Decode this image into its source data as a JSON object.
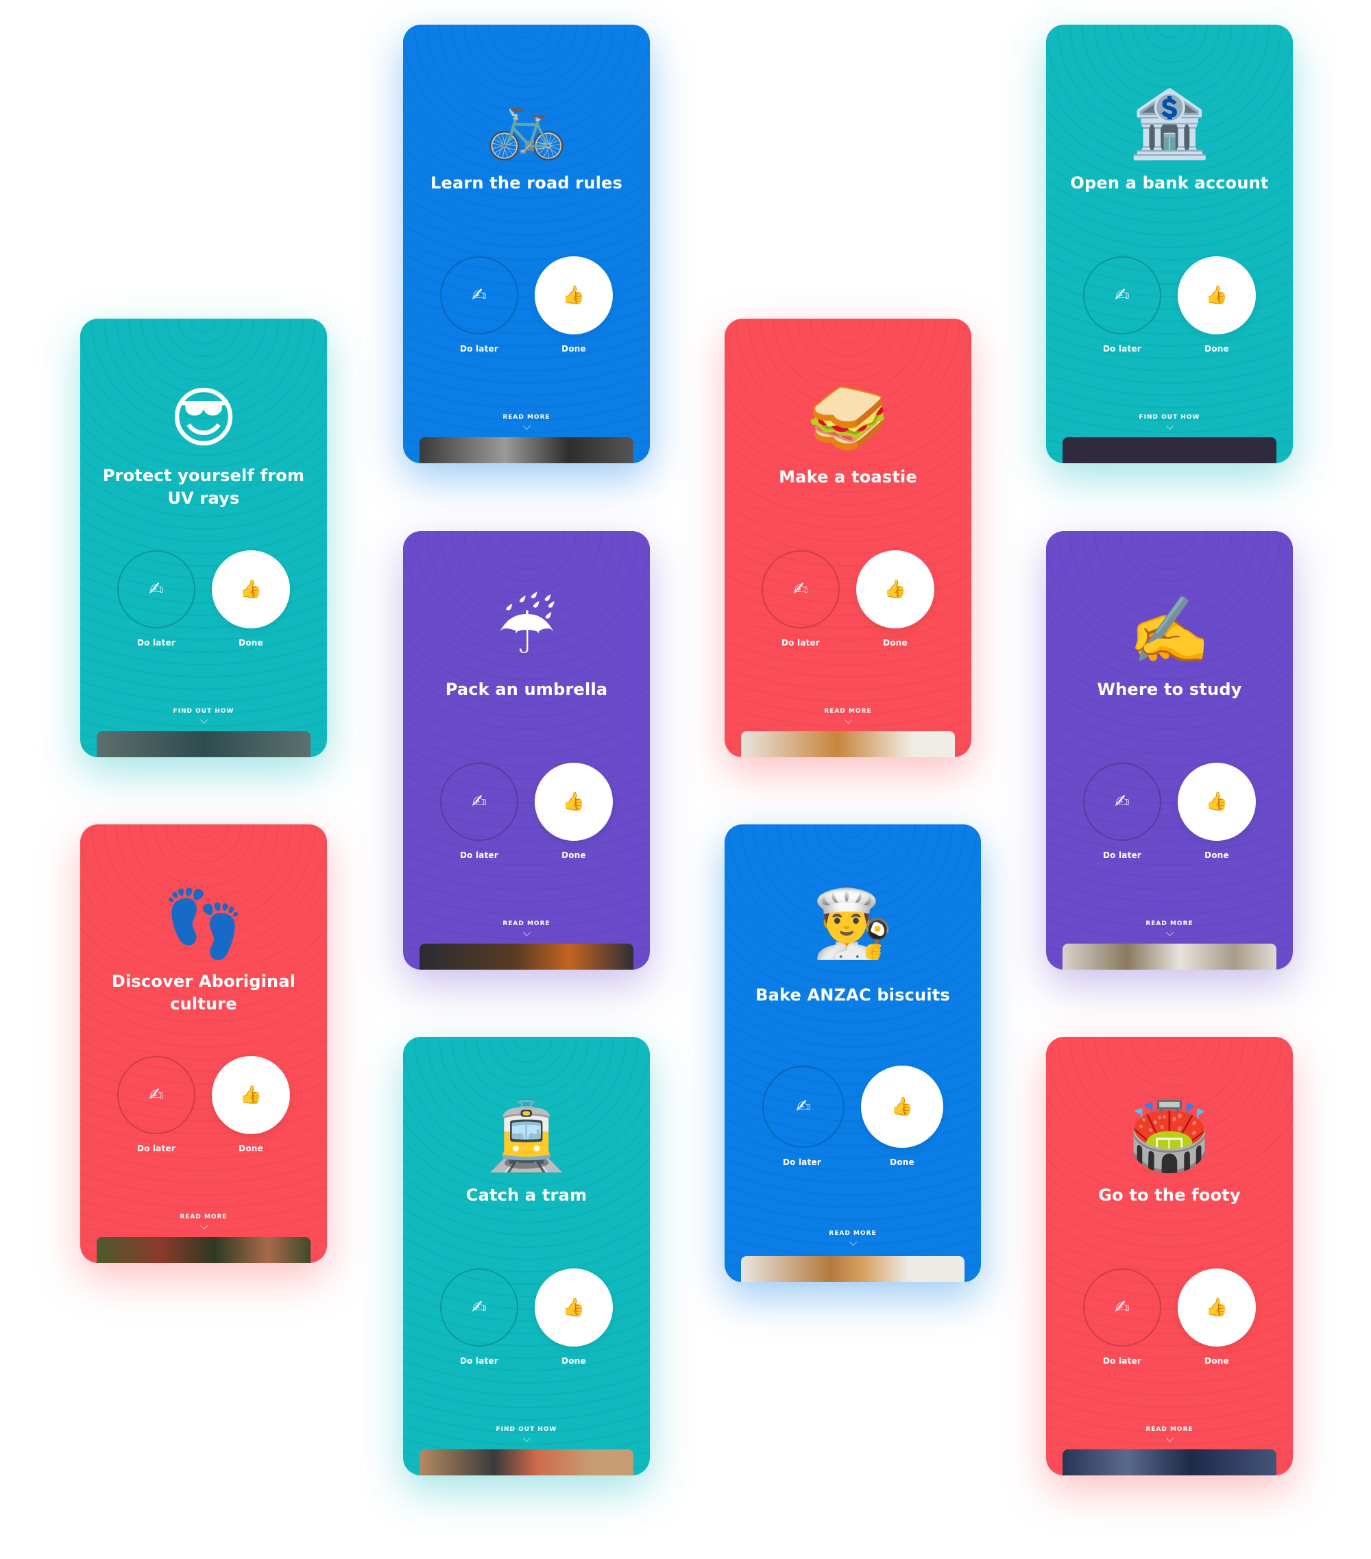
{
  "labels": {
    "do_later": "Do later",
    "done": "Done",
    "do_later_icon": "✍",
    "done_icon": "👍"
  },
  "cards": [
    {
      "title": "Learn the road rules",
      "emoji": "🚲",
      "link": "READ MORE",
      "color": "#0a7de6"
    },
    {
      "title": "Open a bank account",
      "emoji": "🏦",
      "link": "FIND OUT HOW",
      "color": "#0fb9be"
    },
    {
      "title": "Protect yourself from UV rays",
      "emoji": "😎",
      "link": "FIND OUT HOW",
      "color": "#0fb9be"
    },
    {
      "title": "Make a toastie",
      "emoji": "🥪",
      "link": "READ MORE",
      "color": "#fb4d57"
    },
    {
      "title": "Pack an umbrella",
      "emoji": "☔",
      "link": "READ MORE",
      "color": "#6a4bc9"
    },
    {
      "title": "Where to study",
      "emoji": "✍️",
      "link": "READ MORE",
      "color": "#6a4bc9"
    },
    {
      "title": "Discover Aboriginal culture",
      "emoji": "👣",
      "link": "READ MORE",
      "color": "#fb4d57"
    },
    {
      "title": "Bake ANZAC biscuits",
      "emoji": "👨‍🍳",
      "link": "READ MORE",
      "color": "#0a7de6"
    },
    {
      "title": "Catch a tram",
      "emoji": "🚊",
      "link": "FIND OUT HOW",
      "color": "#0fb9be"
    },
    {
      "title": "Go to the footy",
      "emoji": "🏟️",
      "link": "READ MORE",
      "color": "#fb4d57"
    }
  ]
}
